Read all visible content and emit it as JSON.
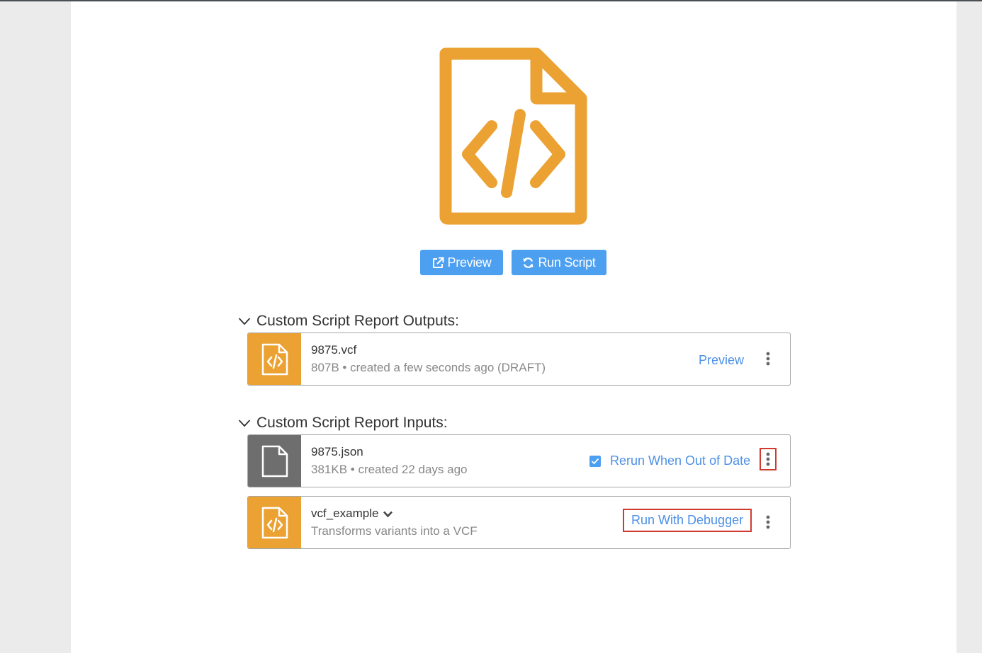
{
  "colors": {
    "accent_blue": "#4d9ff0",
    "link_blue": "#4d90e5",
    "script_orange": "#eba233",
    "file_gray": "#6e6e6e",
    "highlight_red": "#d13b2f"
  },
  "actions": {
    "preview_label": "Preview",
    "run_script_label": "Run Script",
    "preview_icon": "external-link-icon",
    "run_script_icon": "refresh-icon"
  },
  "outputs": {
    "heading": "Custom Script Report Outputs:",
    "items": [
      {
        "name": "9875.vcf",
        "meta": "807B • created a few seconds ago (DRAFT)",
        "icon": "code-file-icon",
        "action_label": "Preview"
      }
    ]
  },
  "inputs": {
    "heading": "Custom Script Report Inputs:",
    "items": [
      {
        "name": "9875.json",
        "meta": "381KB • created 22 days ago",
        "icon": "file-icon",
        "checkbox_checked": true,
        "action_label": "Rerun When Out of Date"
      },
      {
        "name": "vcf_example",
        "meta": "Transforms variants into a VCF",
        "icon": "code-file-icon",
        "action_label": "Run With Debugger"
      }
    ]
  }
}
